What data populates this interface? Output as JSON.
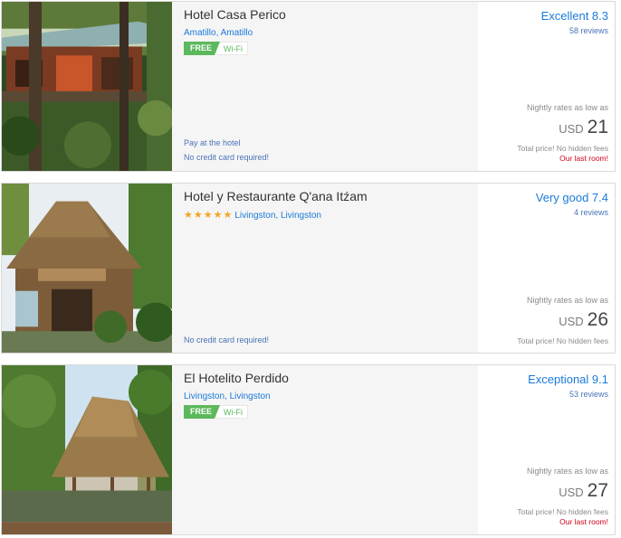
{
  "hotels": [
    {
      "name": "Hotel Casa Perico",
      "location": "Amatillo, Amatillo",
      "wifi": {
        "free": "FREE",
        "label": "Wi-Fi"
      },
      "notes": [
        "Pay at the hotel",
        "No credit card required!"
      ],
      "rating": "Excellent 8.3",
      "reviews": "58 reviews",
      "nightly_label": "Nightly rates as low as",
      "currency": "USD",
      "price": "21",
      "total_note": "Total price! No hidden fees",
      "last_room": "Our last room!"
    },
    {
      "name": "Hotel y Restaurante Q'ana Itźam",
      "stars": 5,
      "location": "Livingston, Livingston",
      "notes": [
        "No credit card required!"
      ],
      "rating": "Very good 7.4",
      "reviews": "4 reviews",
      "nightly_label": "Nightly rates as low as",
      "currency": "USD",
      "price": "26",
      "total_note": "Total price! No hidden fees"
    },
    {
      "name": "El Hotelito Perdido",
      "location": "Livingston, Livingston",
      "wifi": {
        "free": "FREE",
        "label": "Wi-Fi"
      },
      "rating": "Exceptional 9.1",
      "reviews": "53 reviews",
      "nightly_label": "Nightly rates as low as",
      "currency": "USD",
      "price": "27",
      "total_note": "Total price! No hidden fees",
      "last_room": "Our last room!"
    }
  ],
  "colors": {
    "link": "#1a7ad9",
    "wifi_green": "#5cb85c",
    "star": "#f5a623",
    "last_room": "#d0021b"
  },
  "icons": {
    "star": "star-icon"
  }
}
